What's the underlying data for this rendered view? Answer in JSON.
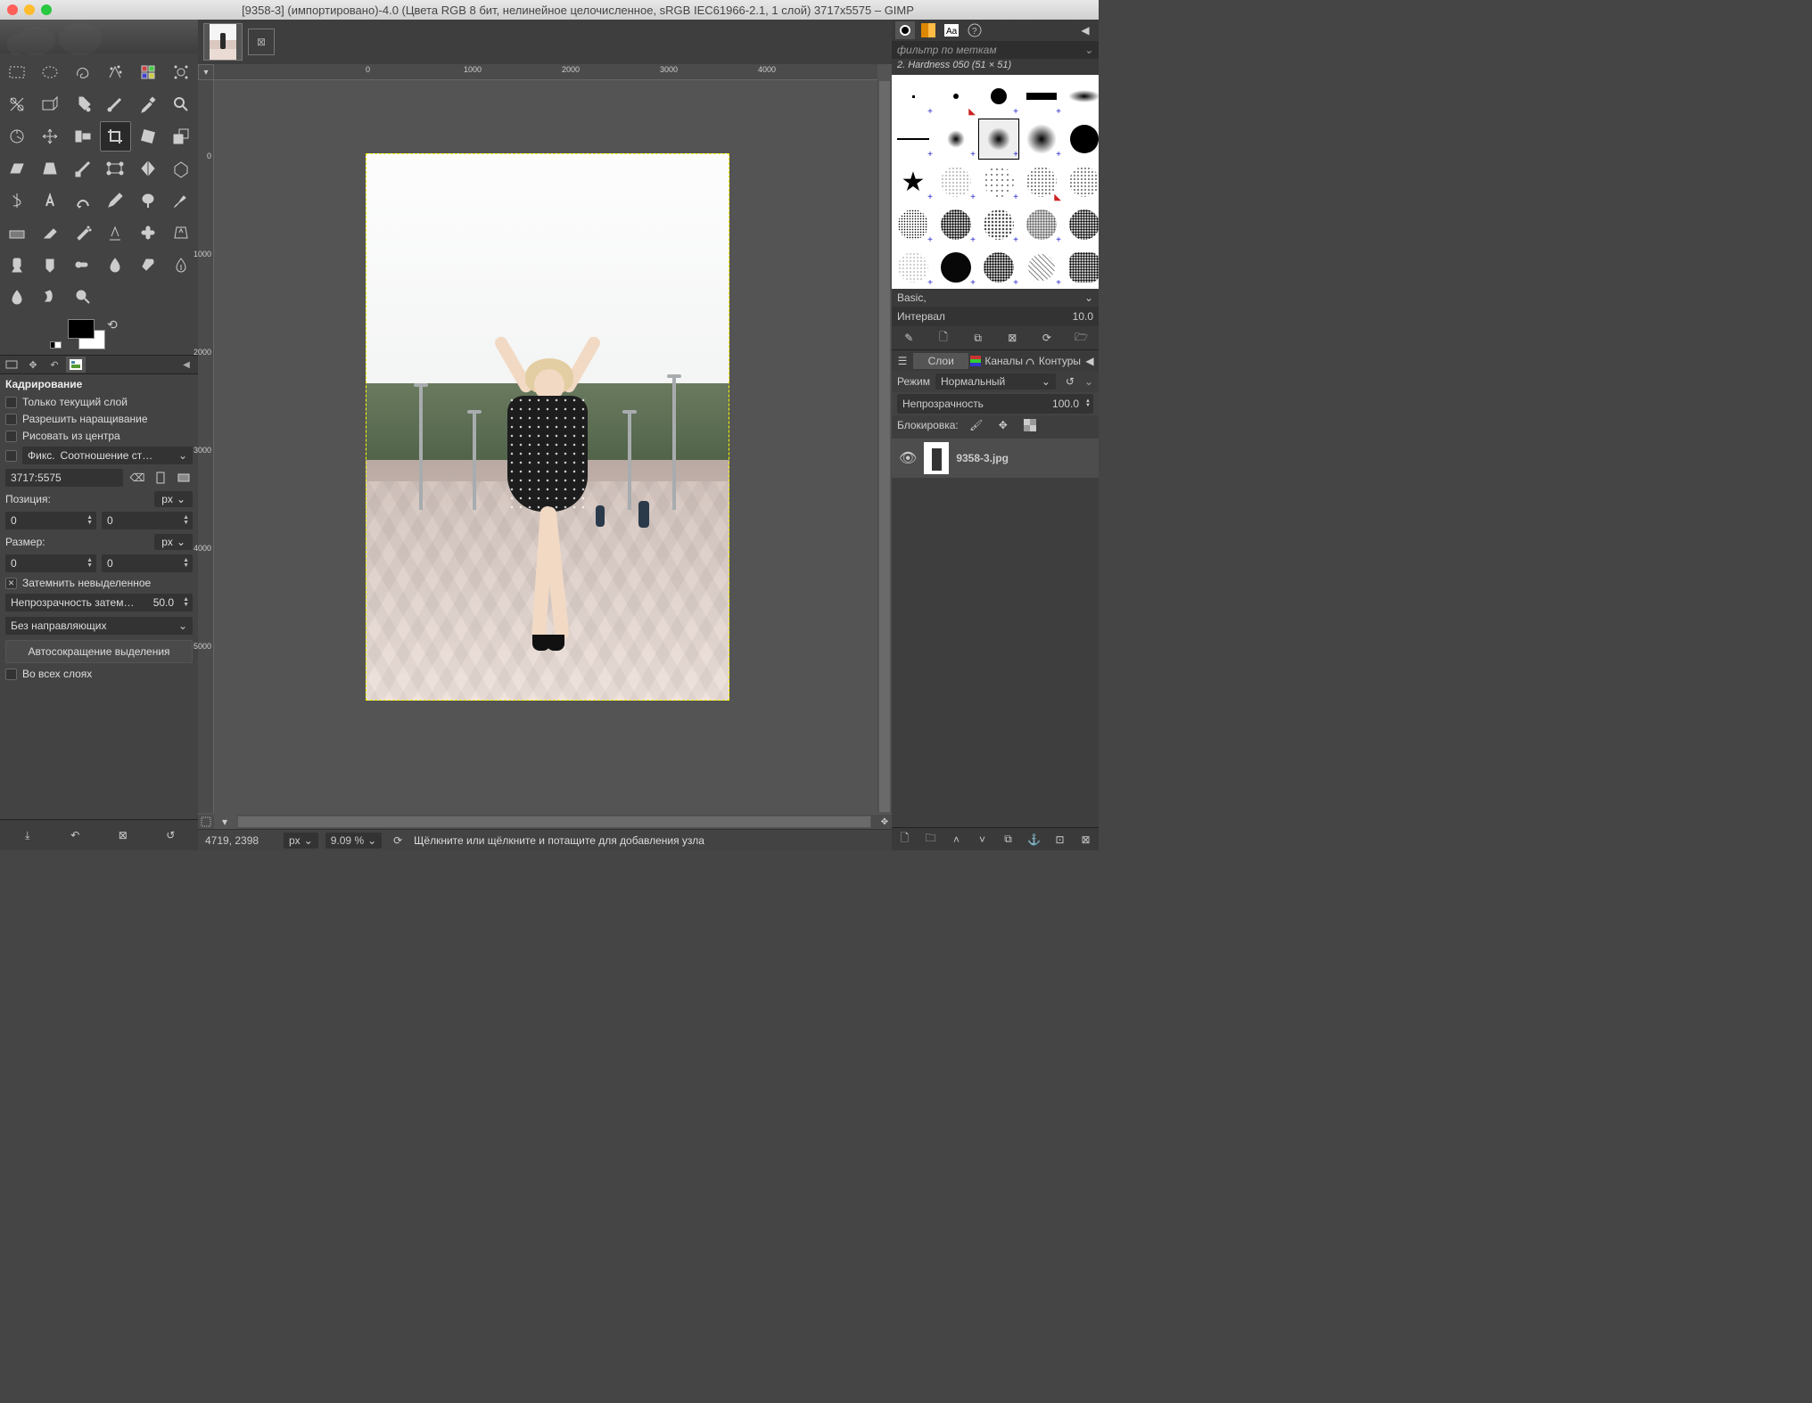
{
  "title": "[9358-3] (импортировано)-4.0 (Цвета RGB 8 бит, нелинейное целочисленное, sRGB IEC61966-2.1, 1 слой) 3717x5575 – GIMP",
  "tag_filter": "фильтр по меткам",
  "brush_name": "2. Hardness 050 (51 × 51)",
  "brush_cat": "Basic,",
  "interval_label": "Интервал",
  "interval_val": "10.0",
  "layers_tabs": {
    "layers": "Слои",
    "channels": "Каналы",
    "paths": "Контуры"
  },
  "mode_label": "Режим",
  "mode_val": "Нормальный",
  "opacity_label": "Непрозрачность",
  "opacity_val": "100.0",
  "lock_label": "Блокировка:",
  "layer_name": "9358-3.jpg",
  "tool_options": {
    "title": "Кадрирование",
    "current_layer": "Только текущий слой",
    "allow_growing": "Разрешить наращивание",
    "from_center": "Рисовать из центра",
    "fixed": "Фикс.",
    "fixed_dropdown": "Соотношение ст…",
    "ratio": "3717:5575",
    "position_lbl": "Позиция:",
    "size_lbl": "Размер:",
    "px": "px",
    "zero": "0",
    "darken": "Затемнить невыделенное",
    "darken_opacity_lbl": "Непрозрачность затем…",
    "darken_opacity_val": "50.0",
    "no_guides": "Без направляющих",
    "autoshrink": "Автосокращение выделения",
    "all_layers": "Во всех слоях"
  },
  "status": {
    "coords": "4719, 2398",
    "unit": "px",
    "zoom": "9.09 %",
    "hint": "Щёлкните или щёлкните и потащите для добавления узла"
  },
  "ruler_h": [
    "0",
    "1000",
    "2000",
    "3000",
    "4000"
  ],
  "ruler_v": [
    "0",
    "1000",
    "2000",
    "3000",
    "4000",
    "5000"
  ]
}
